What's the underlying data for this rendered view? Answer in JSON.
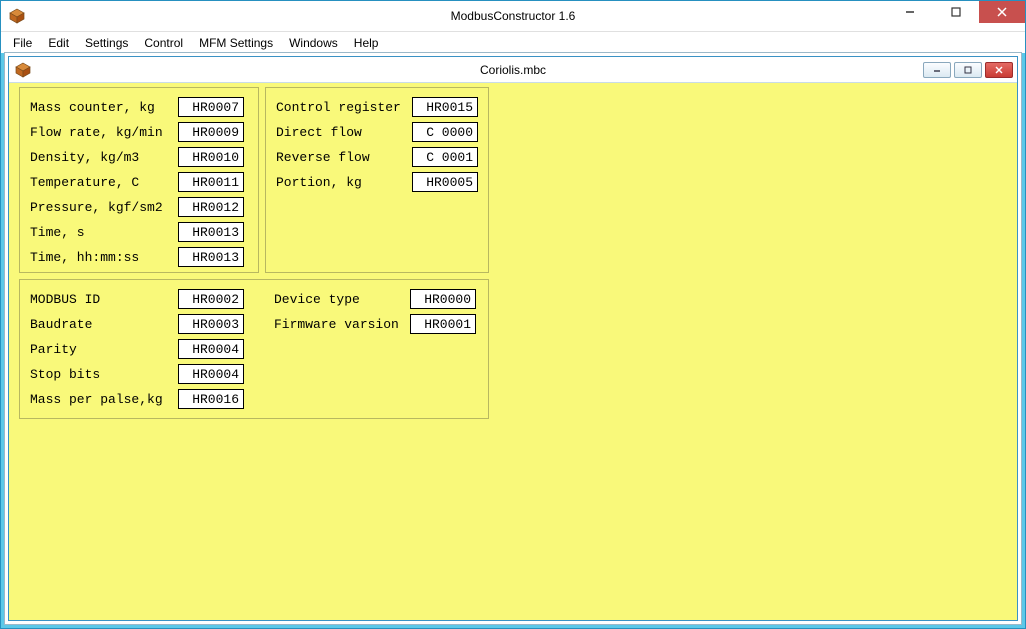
{
  "app": {
    "title": "ModbusConstructor 1.6"
  },
  "menu": [
    "File",
    "Edit",
    "Settings",
    "Control",
    "MFM Settings",
    "Windows",
    "Help"
  ],
  "mdi": {
    "title": "Coriolis.mbc"
  },
  "panel1": {
    "rows": [
      {
        "label": "Mass counter, kg",
        "value": "HR0007"
      },
      {
        "label": "Flow rate, kg/min",
        "value": "HR0009"
      },
      {
        "label": "Density, kg/m3",
        "value": "HR0010"
      },
      {
        "label": "Temperature, C",
        "value": "HR0011"
      },
      {
        "label": "Pressure, kgf/sm2",
        "value": "HR0012"
      },
      {
        "label": "Time, s",
        "value": "HR0013"
      },
      {
        "label": "Time, hh:mm:ss",
        "value": "HR0013"
      }
    ]
  },
  "panel2": {
    "rows": [
      {
        "label": "Control register",
        "value": "HR0015"
      },
      {
        "label": "Direct flow",
        "value": "C 0000"
      },
      {
        "label": "Reverse flow",
        "value": "C 0001"
      },
      {
        "label": "Portion, kg",
        "value": "HR0005"
      }
    ]
  },
  "panel3": {
    "left": [
      {
        "label": "MODBUS ID",
        "value": "HR0002"
      },
      {
        "label": "Baudrate",
        "value": "HR0003"
      },
      {
        "label": "Parity",
        "value": "HR0004"
      },
      {
        "label": "Stop bits",
        "value": "HR0004"
      },
      {
        "label": "Mass per palse,kg",
        "value": "HR0016"
      }
    ],
    "right": [
      {
        "label": "Device type",
        "value": "HR0000"
      },
      {
        "label": "Firmware varsion",
        "value": "HR0001"
      }
    ]
  }
}
